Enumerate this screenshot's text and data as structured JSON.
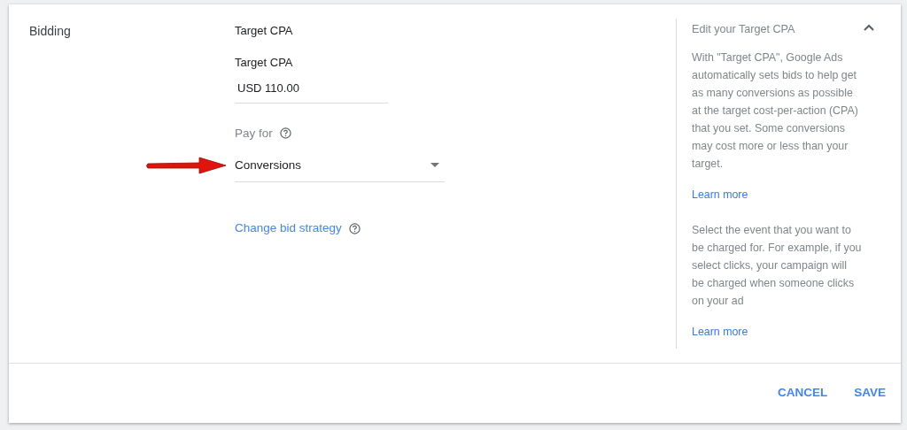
{
  "section_label": "Bidding",
  "strategy_title": "Target CPA",
  "target_cpa": {
    "label": "Target CPA",
    "value": "USD 110.00"
  },
  "pay_for": {
    "label": "Pay for",
    "value": "Conversions"
  },
  "change_link": "Change bid strategy",
  "help": {
    "title": "Edit your Target CPA",
    "expanded": true,
    "paragraphs": [
      {
        "text": "With \"Target CPA\", Google Ads automatically sets bids to help get as many conversions as possible at the target cost-per-action (CPA) that you set. Some conversions may cost more or less than your target.",
        "link": "Learn more"
      },
      {
        "text": "Select the event that you want to be charged for. For example, if you select clicks, your campaign will be charged when someone clicks on your ad",
        "link": "Learn more"
      }
    ]
  },
  "buttons": [
    "CANCEL",
    "SAVE"
  ]
}
